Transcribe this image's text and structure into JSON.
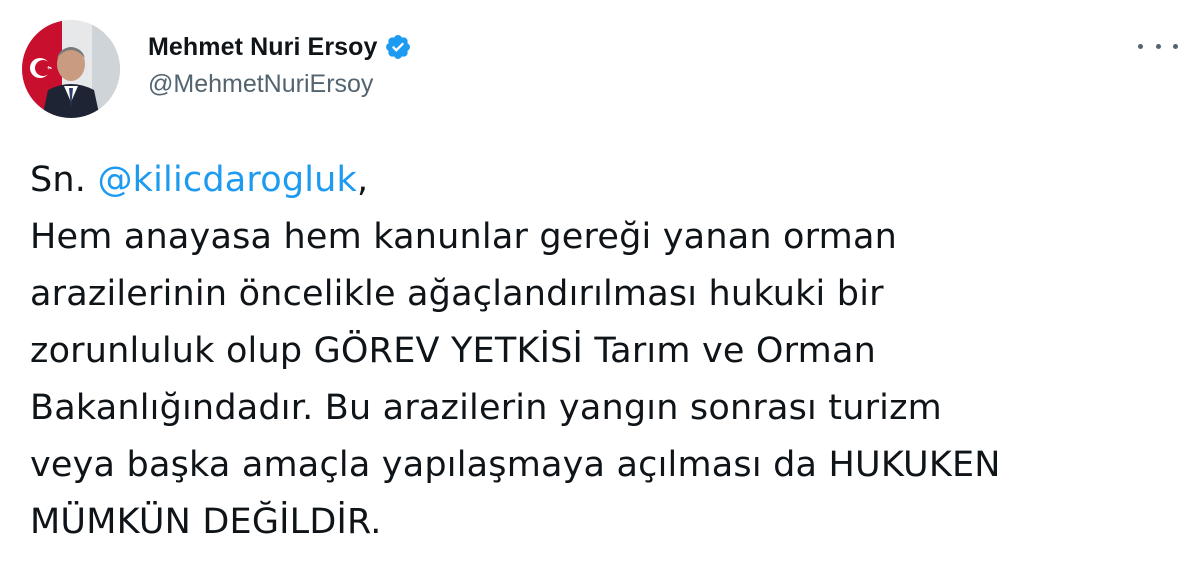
{
  "author": {
    "display_name": "Mehmet Nuri Ersoy",
    "handle": "@MehmetNuriErsoy",
    "verified": true
  },
  "tweet": {
    "prefix": "Sn. ",
    "mention": "@kilicdarogluk",
    "mention_suffix": ",",
    "lines": [
      "Hem anayasa hem kanunlar gereği yanan orman",
      "arazilerinin öncelikle ağaçlandırılması hukuki bir",
      "zorunluluk olup GÖREV YETKİSİ Tarım ve Orman",
      "Bakanlığındadır. Bu arazilerin yangın sonrası turizm",
      "veya başka amaçla yapılaşmaya açılması da HUKUKEN",
      "MÜMKÜN DEĞİLDİR."
    ]
  },
  "icons": {
    "verified": "verified-badge-icon",
    "more": "more-options-icon"
  },
  "colors": {
    "accent": "#1d9bf0",
    "text": "#0f1419",
    "secondary": "#536471"
  }
}
